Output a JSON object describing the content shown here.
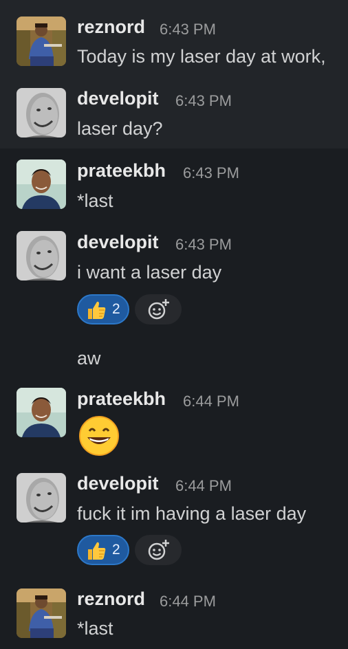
{
  "messages": [
    {
      "user": "reznord",
      "time": "6:43 PM",
      "text": "Today is my laser day at work,"
    },
    {
      "user": "developit",
      "time": "6:43 PM",
      "text": "laser day?"
    },
    {
      "user": "prateekbh",
      "time": "6:43 PM",
      "text": "*last"
    },
    {
      "user": "developit",
      "time": "6:43 PM",
      "text": "i want a laser day",
      "reaction": {
        "emoji": "thumbs-up",
        "count": "2"
      }
    },
    {
      "text": "aw"
    },
    {
      "user": "prateekbh",
      "time": "6:44 PM",
      "emoji": "grinning-face"
    },
    {
      "user": "developit",
      "time": "6:44 PM",
      "text": "fuck it im having a laser day",
      "reaction": {
        "emoji": "thumbs-up",
        "count": "2"
      }
    },
    {
      "user": "reznord",
      "time": "6:44 PM",
      "text": "*last"
    }
  ],
  "colors": {
    "background": "#1a1d21",
    "highlight_row": "#222529",
    "reaction_bg": "#1f5aa0",
    "reaction_border": "#2c78c9"
  }
}
